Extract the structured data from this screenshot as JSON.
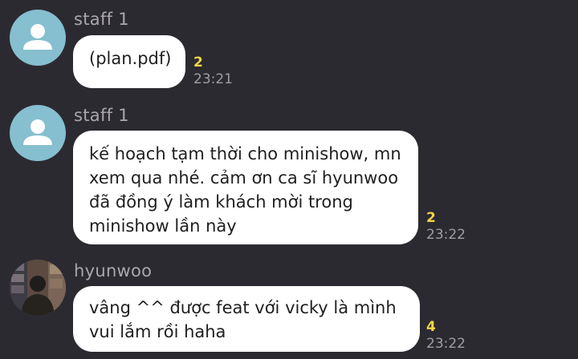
{
  "messages": [
    {
      "sender": "staff 1",
      "avatar_icon": "default-user-icon",
      "text": "(plan.pdf)",
      "unread_count": "2",
      "time": "23:21"
    },
    {
      "sender": "staff 1",
      "avatar_icon": "default-user-icon",
      "text_lines": [
        "kế hoạch tạm thời cho minishow, mn",
        "xem qua nhé. cảm ơn ca sĩ hyunwoo",
        "đã đồng ý làm khách mời trong",
        "minishow lần này"
      ],
      "unread_count": "2",
      "time": "23:22"
    },
    {
      "sender": "hyunwoo",
      "avatar_icon": "profile-photo",
      "text_lines": [
        "vâng ^^ được feat với vicky là mình",
        "vui lắm rồi haha"
      ],
      "unread_count": "4",
      "time": "23:22"
    }
  ],
  "colors": {
    "background": "#2c2a31",
    "bubble": "#ffffff",
    "unread": "#f1d645",
    "avatar_default": "#86bfcf"
  }
}
